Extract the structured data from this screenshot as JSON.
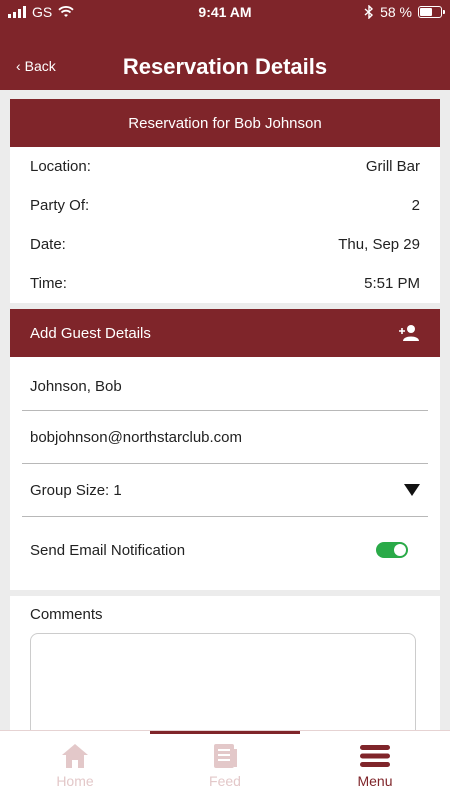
{
  "status_bar": {
    "carrier": "GS",
    "time": "9:41 AM",
    "battery": "58 %",
    "battery_level": 0.58
  },
  "header": {
    "back_label": "Back",
    "title": "Reservation Details"
  },
  "reservation": {
    "heading": "Reservation for Bob Johnson",
    "rows": [
      {
        "label": "Location:",
        "value": "Grill Bar"
      },
      {
        "label": "Party Of:",
        "value": "2"
      },
      {
        "label": "Date:",
        "value": "Thu, Sep 29"
      },
      {
        "label": "Time:",
        "value": "5:51 PM"
      }
    ]
  },
  "guest": {
    "heading": "Add Guest Details",
    "name": "Johnson, Bob",
    "email": "bobjohnson@northstarclub.com",
    "group_size": "Group Size: 1",
    "notify_label": "Send Email Notification",
    "notify_enabled": true
  },
  "comments": {
    "label": "Comments",
    "value": ""
  },
  "tabs": [
    {
      "label": "Home",
      "icon": "home-icon",
      "active": false
    },
    {
      "label": "Feed",
      "icon": "feed-icon",
      "active": false
    },
    {
      "label": "Menu",
      "icon": "menu-icon",
      "active": true
    }
  ],
  "colors": {
    "brand": "#7f252a",
    "toggle_on": "#2aaa48",
    "inactive_tab": "#e3c8c9"
  }
}
